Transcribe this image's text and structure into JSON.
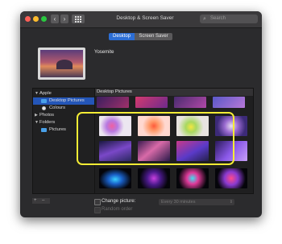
{
  "window": {
    "title": "Desktop & Screen Saver"
  },
  "nav": {
    "back": "‹",
    "forward": "›"
  },
  "search": {
    "placeholder": "Search",
    "icon": "search-icon"
  },
  "tabs": [
    {
      "label": "Desktop",
      "selected": true
    },
    {
      "label": "Screen Saver",
      "selected": false
    }
  ],
  "current_picture": {
    "name": "Yosemite"
  },
  "sidebar": {
    "items": [
      {
        "label": "Apple",
        "indent": 0,
        "expanded": true
      },
      {
        "label": "Desktop Pictures",
        "indent": 1,
        "selected": true,
        "icon": "folder-icon"
      },
      {
        "label": "Colours",
        "indent": 1,
        "icon": "color-dot-icon"
      },
      {
        "label": "Photos",
        "indent": 0,
        "expanded": false
      },
      {
        "label": "Folders",
        "indent": 0,
        "expanded": true
      },
      {
        "label": "Pictures",
        "indent": 1,
        "icon": "folder-icon"
      }
    ]
  },
  "grid": {
    "header": "Desktop Pictures",
    "highlight_color": "#f4ec35"
  },
  "footer": {
    "add_label": "+",
    "remove_label": "–",
    "change_picture_label": "Change picture:",
    "interval": "Every 30 minutes",
    "random_order_label": "Random order",
    "help": "?"
  },
  "colors": {
    "accent": "#2c6ed5",
    "window": "#2b2b2d",
    "highlight": "#f4ec35"
  }
}
